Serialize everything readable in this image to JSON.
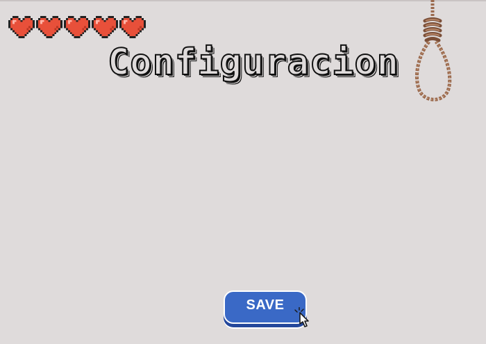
{
  "screen": {
    "title": "Configuracion"
  },
  "lives": {
    "count": 5,
    "icon": "heart-icon",
    "color": "#e8503a"
  },
  "buttons": {
    "save_label": "SAVE",
    "save_color": "#3a69c6"
  },
  "decorations": {
    "noose_icon": "noose-icon",
    "rope_color": "#9b6a4e",
    "cursor_icon": "hand-cursor-icon"
  }
}
